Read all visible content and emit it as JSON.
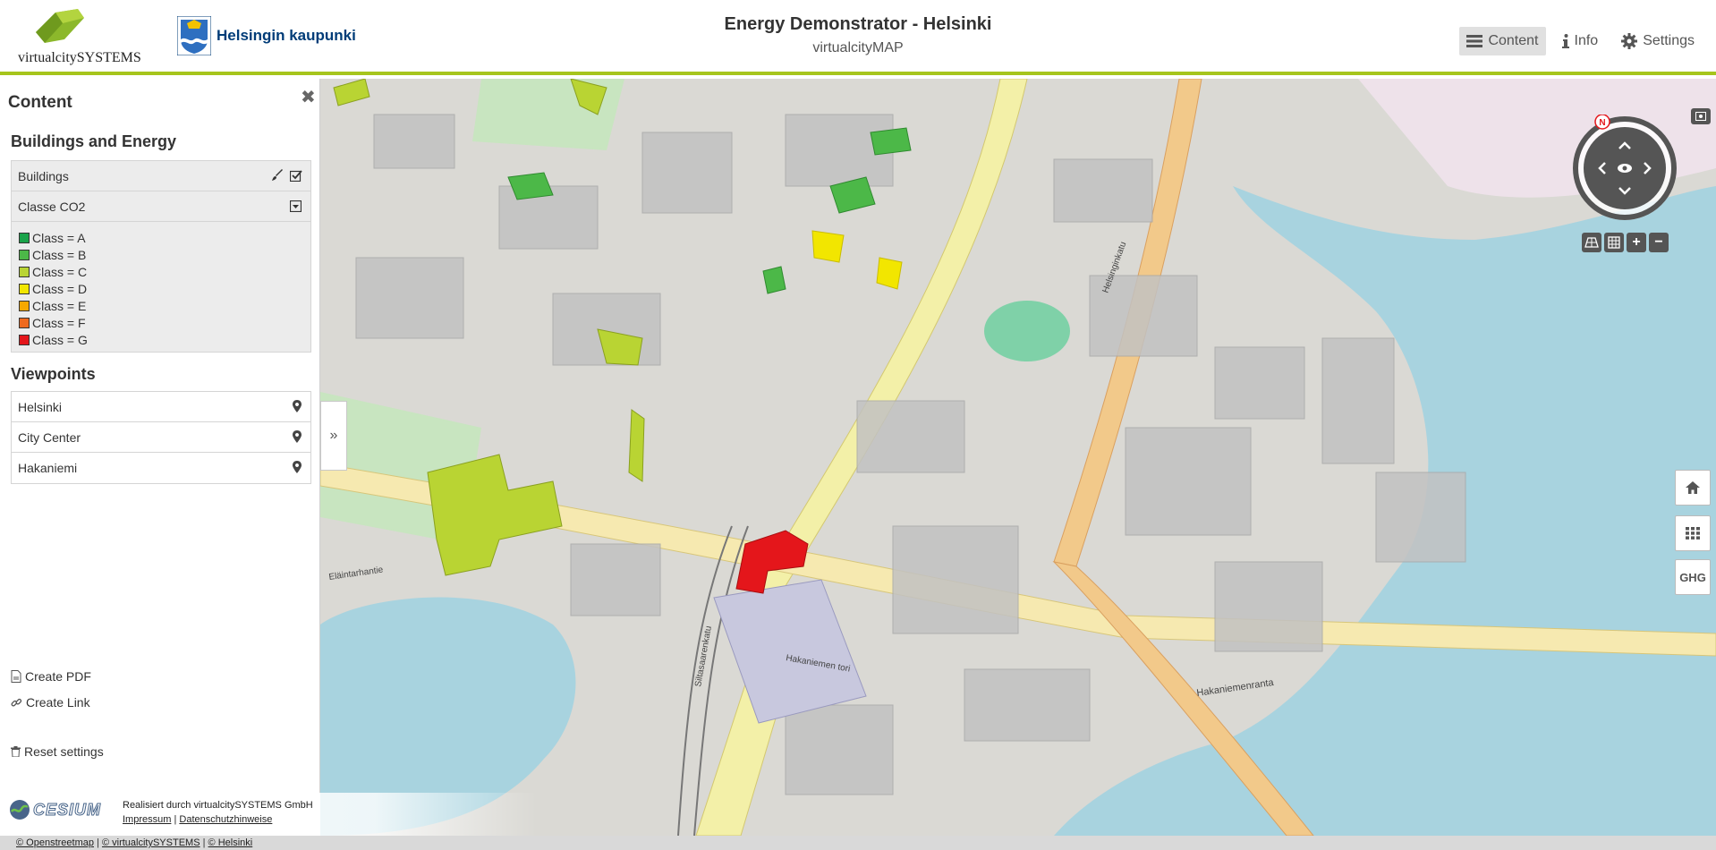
{
  "header": {
    "logo_text": "virtualcitySYSTEMS",
    "city_name": "Helsingin kaupunki",
    "title": "Energy Demonstrator - Helsinki",
    "subtitle": "virtualcityMAP",
    "nav": [
      {
        "label": "Content",
        "icon": "list-icon",
        "active": true
      },
      {
        "label": "Info",
        "icon": "info-icon",
        "active": false
      },
      {
        "label": "Settings",
        "icon": "gear-icon",
        "active": false
      }
    ],
    "accent_color": "#a6c51c"
  },
  "sidebar": {
    "title": "Content",
    "close_symbol": "✖",
    "buildings_section": {
      "heading": "Buildings and Energy",
      "layer_label": "Buildings",
      "style_label": "Classe CO2",
      "legend": [
        {
          "label": "Class = A",
          "color": "#1aa34a"
        },
        {
          "label": "Class = B",
          "color": "#4cb848"
        },
        {
          "label": "Class = C",
          "color": "#b9d433"
        },
        {
          "label": "Class = D",
          "color": "#f2e600"
        },
        {
          "label": "Class = E",
          "color": "#f6a800"
        },
        {
          "label": "Class = F",
          "color": "#ee6a1f"
        },
        {
          "label": "Class = G",
          "color": "#e4161b"
        }
      ]
    },
    "viewpoints_section": {
      "heading": "Viewpoints",
      "items": [
        {
          "label": "Helsinki"
        },
        {
          "label": "City Center"
        },
        {
          "label": "Hakaniemi"
        }
      ]
    },
    "actions": {
      "create_pdf": "Create PDF",
      "create_link": "Create Link",
      "reset": "Reset settings"
    }
  },
  "map": {
    "expand_symbol": "»",
    "compass_north": "N",
    "tools": [
      "+",
      "−"
    ],
    "side_buttons": {
      "ghg": "GHG"
    },
    "street_labels": [
      "Hakaniemen tori",
      "Siltasaarenkatu",
      "Hakaniemenranta",
      "Eläintarhantie",
      "Helsinginkatu"
    ]
  },
  "footer": {
    "cesium": "CESIUM",
    "credit": "Realisiert durch virtualcitySYSTEMS GmbH",
    "impressum": "Impressum",
    "datenschutz": "Datenschutzhinweise",
    "sep": "|",
    "bottom": [
      "© Openstreetmap",
      "© virtualcitySYSTEMS",
      "© Helsinki"
    ]
  }
}
